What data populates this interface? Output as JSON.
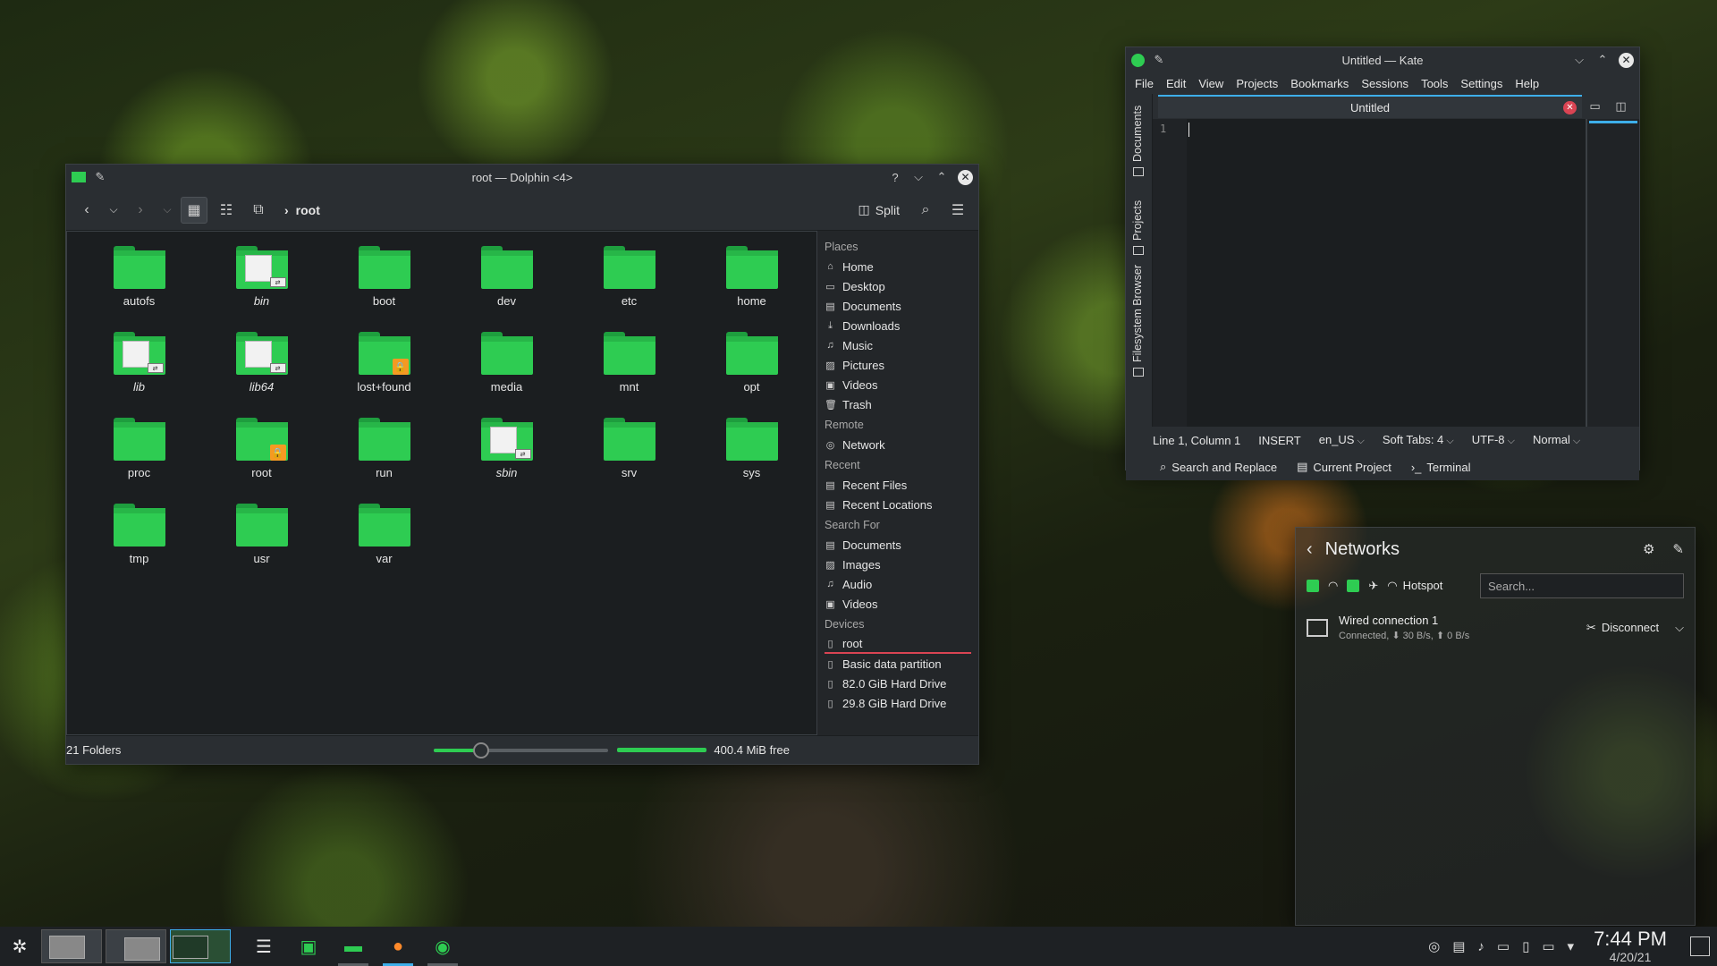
{
  "dolphin": {
    "title": "root — Dolphin <4>",
    "breadcrumb": "root",
    "split_label": "Split",
    "folders": [
      {
        "name": "autofs",
        "italic": false,
        "badge": ""
      },
      {
        "name": "bin",
        "italic": true,
        "badge": "link"
      },
      {
        "name": "boot",
        "italic": false,
        "badge": ""
      },
      {
        "name": "dev",
        "italic": false,
        "badge": ""
      },
      {
        "name": "etc",
        "italic": false,
        "badge": ""
      },
      {
        "name": "home",
        "italic": false,
        "badge": ""
      },
      {
        "name": "lib",
        "italic": true,
        "badge": "link"
      },
      {
        "name": "lib64",
        "italic": true,
        "badge": "link"
      },
      {
        "name": "lost+found",
        "italic": false,
        "badge": "lock"
      },
      {
        "name": "media",
        "italic": false,
        "badge": ""
      },
      {
        "name": "mnt",
        "italic": false,
        "badge": ""
      },
      {
        "name": "opt",
        "italic": false,
        "badge": ""
      },
      {
        "name": "proc",
        "italic": false,
        "badge": ""
      },
      {
        "name": "root",
        "italic": false,
        "badge": "lock"
      },
      {
        "name": "run",
        "italic": false,
        "badge": ""
      },
      {
        "name": "sbin",
        "italic": true,
        "badge": "link"
      },
      {
        "name": "srv",
        "italic": false,
        "badge": ""
      },
      {
        "name": "sys",
        "italic": false,
        "badge": ""
      },
      {
        "name": "tmp",
        "italic": false,
        "badge": ""
      },
      {
        "name": "usr",
        "italic": false,
        "badge": ""
      },
      {
        "name": "var",
        "italic": false,
        "badge": ""
      }
    ],
    "places": {
      "places_header": "Places",
      "places_items": [
        {
          "label": "Home",
          "icon": "⌂"
        },
        {
          "label": "Desktop",
          "icon": "▭"
        },
        {
          "label": "Documents",
          "icon": "▤"
        },
        {
          "label": "Downloads",
          "icon": "⤓"
        },
        {
          "label": "Music",
          "icon": "♫"
        },
        {
          "label": "Pictures",
          "icon": "▨"
        },
        {
          "label": "Videos",
          "icon": "▣"
        },
        {
          "label": "Trash",
          "icon": "🗑"
        }
      ],
      "remote_header": "Remote",
      "remote_items": [
        {
          "label": "Network",
          "icon": "◎"
        }
      ],
      "recent_header": "Recent",
      "recent_items": [
        {
          "label": "Recent Files",
          "icon": "▤"
        },
        {
          "label": "Recent Locations",
          "icon": "▤"
        }
      ],
      "search_header": "Search For",
      "search_items": [
        {
          "label": "Documents",
          "icon": "▤"
        },
        {
          "label": "Images",
          "icon": "▨"
        },
        {
          "label": "Audio",
          "icon": "♫"
        },
        {
          "label": "Videos",
          "icon": "▣"
        }
      ],
      "devices_header": "Devices",
      "devices_items": [
        {
          "label": "root",
          "icon": "▯"
        },
        {
          "label": "Basic data partition",
          "icon": "▯"
        },
        {
          "label": "82.0 GiB Hard Drive",
          "icon": "▯"
        },
        {
          "label": "29.8 GiB Hard Drive",
          "icon": "▯"
        }
      ]
    },
    "status": {
      "count": "21 Folders",
      "zoom_fraction": 0.27,
      "free_fraction": 1.0,
      "free_text": "400.4 MiB free"
    }
  },
  "kate": {
    "title": "Untitled — Kate",
    "menu": [
      "File",
      "Edit",
      "View",
      "Projects",
      "Bookmarks",
      "Sessions",
      "Tools",
      "Settings",
      "Help"
    ],
    "side_tabs": [
      "Documents",
      "Projects",
      "Filesystem Browser"
    ],
    "tab_label": "Untitled",
    "line_number": "1",
    "status": {
      "position": "Line 1, Column 1",
      "mode": "INSERT",
      "language": "en_US",
      "indent": "Soft Tabs: 4",
      "encoding": "UTF-8",
      "input_mode": "Normal"
    },
    "bottom": {
      "search": "Search and Replace",
      "project": "Current Project",
      "terminal": "Terminal"
    }
  },
  "networks": {
    "title": "Networks",
    "hotspot": "Hotspot",
    "search_placeholder": "Search...",
    "connection": {
      "name": "Wired connection 1",
      "detail": "Connected, ⬇ 30 B/s, ⬆ 0 B/s",
      "action": "Disconnect"
    }
  },
  "taskbar": {
    "time": "7:44 PM",
    "date": "4/20/21"
  }
}
